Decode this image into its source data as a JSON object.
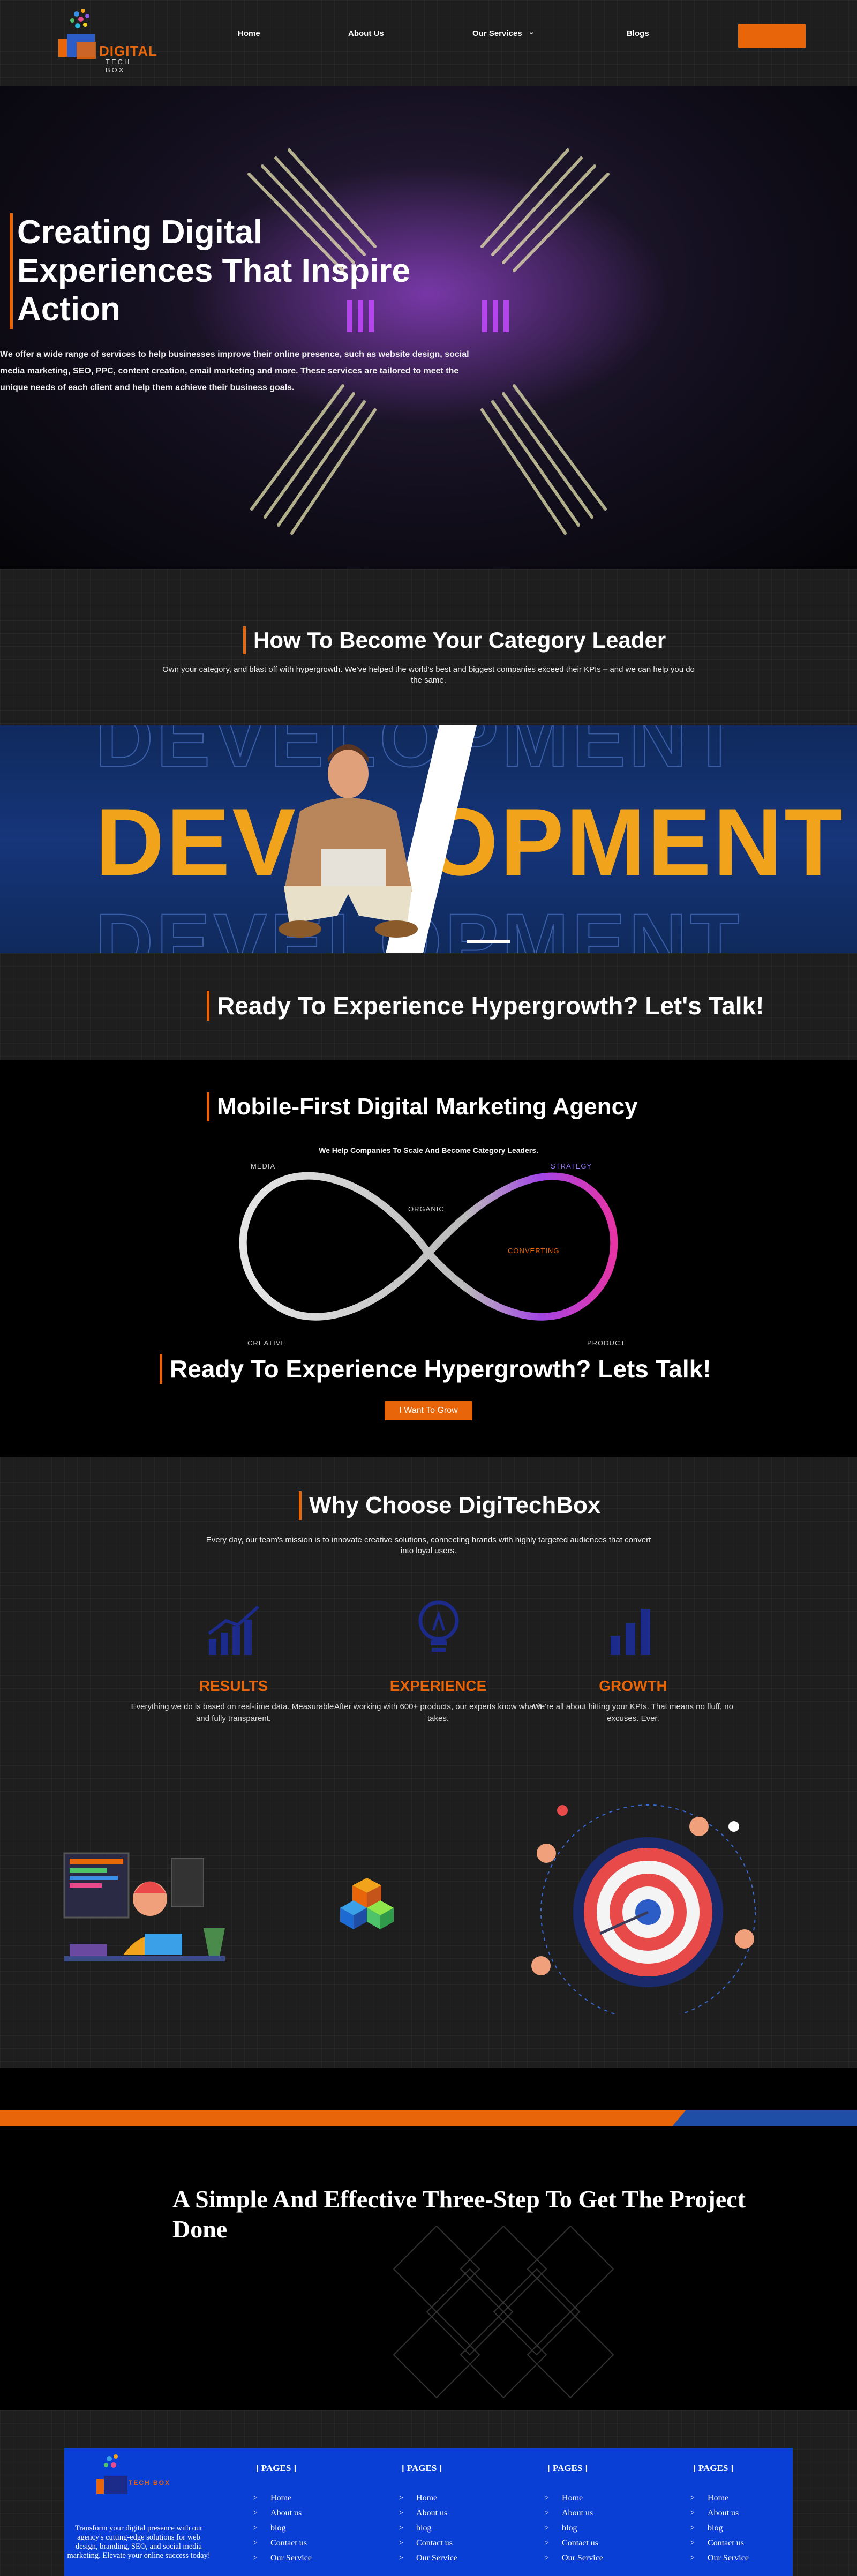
{
  "header": {
    "logo_text": "DIGITAL",
    "logo_sub": "TECH BOX",
    "nav": [
      "Home",
      "About Us",
      "Our Services",
      "Blogs"
    ]
  },
  "hero": {
    "title": "Creating Digital Experiences That Inspire Action",
    "description": "We offer a wide range of services to help businesses improve their online presence, such as website design, social media marketing, SEO, PPC, content creation, email marketing and more. These services are tailored to meet the unique needs of each client and help them achieve their business goals."
  },
  "category": {
    "title": "How To Become Your Category Leader",
    "text": "Own your category, and blast off with hypergrowth. We've helped the world's best and biggest companies exceed their KPIs – and we can help you do the same."
  },
  "dev_banner": {
    "word": "DEVELOPMENT"
  },
  "talk1": {
    "title": "Ready To Experience Hypergrowth? Let's Talk!"
  },
  "agency": {
    "title": "Mobile-First Digital Marketing Agency",
    "subtitle": "We Help Companies To Scale And Become Category Leaders.",
    "labels": {
      "media": "MEDIA",
      "organic": "ORGANIC",
      "strategy": "STRATEGY",
      "converting": "CONVERTING",
      "creative": "CREATIVE",
      "product": "PRODUCT"
    },
    "talk_title": "Ready To Experience Hypergrowth? Lets Talk!",
    "button": "I Want To Grow"
  },
  "why": {
    "title": "Why Choose DigiTechBox",
    "text": "Every day, our team's mission is to innovate creative solutions, connecting brands with highly targeted audiences that convert into loyal users.",
    "features": [
      {
        "icon": "chart-growth-icon",
        "title": "RESULTS",
        "text": "Everything we do is based on real-time data. Measurable, and fully transparent."
      },
      {
        "icon": "lightbulb-icon",
        "title": "EXPERIENCE",
        "text": "After working with 600+ products, our experts know what it takes."
      },
      {
        "icon": "bar-chart-icon",
        "title": "GROWTH",
        "text": "We're all about hitting your KPIs. That means no fluff, no excuses. Ever."
      }
    ]
  },
  "steps": {
    "title": "A Simple And Effective Three-Step To Get The Project Done"
  },
  "footer": {
    "about": "Transform your digital presence with our agency's cutting-edge solutions for web design, branding, SEO, and social media marketing. Elevate your online success today!",
    "columns": [
      {
        "heading": "[ PAGES ]",
        "links": [
          "Home",
          "About us",
          "blog",
          "Contact us",
          "Our Service"
        ]
      },
      {
        "heading": "[ PAGES ]",
        "links": [
          "Home",
          "About us",
          "blog",
          "Contact us",
          "Our Service"
        ]
      },
      {
        "heading": "[ PAGES ]",
        "links": [
          "Home",
          "About us",
          "blog",
          "Contact us",
          "Our Service"
        ]
      },
      {
        "heading": "[ PAGES ]",
        "links": [
          "Home",
          "About us",
          "blog",
          "Contact us",
          "Our Service"
        ]
      }
    ]
  },
  "colors": {
    "accent": "#e8650a",
    "footer_blue": "#0a3fd6",
    "banner_gold": "#f2a31c"
  }
}
